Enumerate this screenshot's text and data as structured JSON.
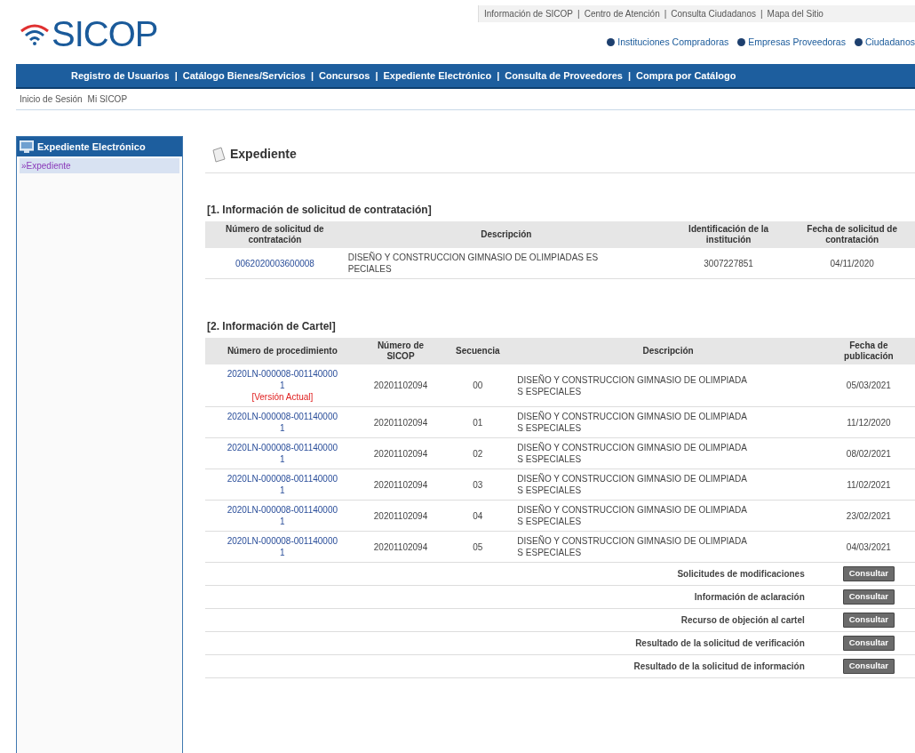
{
  "header": {
    "logo": "SICOP",
    "separator": "|",
    "top_links": [
      "Información de SICOP",
      "Centro de Atención",
      "Consulta Ciudadanos",
      "Mapa del Sitio"
    ],
    "user_links": [
      "Instituciones Compradoras",
      "Empresas Proveedoras",
      "Ciudadanos"
    ]
  },
  "main_nav": {
    "separator": "|",
    "items": [
      "Registro de Usuarios",
      "Catálogo Bienes/Servicios",
      "Concursos",
      "Expediente Electrónico",
      "Consulta de Proveedores",
      "Compra por Catálogo"
    ]
  },
  "breadcrumb": [
    "Inicio de Sesión",
    "Mi SICOP"
  ],
  "sidebar": {
    "title": "Expediente Electrónico",
    "items": [
      {
        "label": "»Expediente",
        "selected": true
      }
    ]
  },
  "page_title": "Expediente",
  "section1": {
    "title": "[1. Información de solicitud de contratación]",
    "columns": [
      "Número de solicitud de contratación",
      "Descripción",
      "Identificación de la institución",
      "Fecha de solicitud de contratación"
    ],
    "rows": [
      {
        "number": "0062020003600008",
        "description": "DISEÑO Y CONSTRUCCION GIMNASIO DE OLIMPIADAS ESPECIALES",
        "institution": "3007227851",
        "date": "04/11/2020"
      }
    ]
  },
  "section2": {
    "title": "[2. Información de Cartel]",
    "columns": [
      "Número de procedimiento",
      "Número de SICOP",
      "Secuencia",
      "Descripción",
      "Fecha de publicación"
    ],
    "rows": [
      {
        "procedure": "2020LN-000008-0011400001",
        "badge": "[Versión Actual]",
        "sicop": "20201102094",
        "sequence": "00",
        "description": "DISEÑO Y CONSTRUCCION GIMNASIO DE OLIMPIADAS ESPECIALES",
        "date": "05/03/2021"
      },
      {
        "procedure": "2020LN-000008-0011400001",
        "sicop": "20201102094",
        "sequence": "01",
        "description": "DISEÑO Y CONSTRUCCION GIMNASIO DE OLIMPIADAS ESPECIALES",
        "date": "11/12/2020"
      },
      {
        "procedure": "2020LN-000008-0011400001",
        "sicop": "20201102094",
        "sequence": "02",
        "description": "DISEÑO Y CONSTRUCCION GIMNASIO DE OLIMPIADAS ESPECIALES",
        "date": "08/02/2021"
      },
      {
        "procedure": "2020LN-000008-0011400001",
        "sicop": "20201102094",
        "sequence": "03",
        "description": "DISEÑO Y CONSTRUCCION GIMNASIO DE OLIMPIADAS ESPECIALES",
        "date": "11/02/2021"
      },
      {
        "procedure": "2020LN-000008-0011400001",
        "sicop": "20201102094",
        "sequence": "04",
        "description": "DISEÑO Y CONSTRUCCION GIMNASIO DE OLIMPIADAS ESPECIALES",
        "date": "23/02/2021"
      },
      {
        "procedure": "2020LN-000008-0011400001",
        "sicop": "20201102094",
        "sequence": "05",
        "description": "DISEÑO Y CONSTRUCCION GIMNASIO DE OLIMPIADAS ESPECIALES",
        "date": "04/03/2021"
      }
    ],
    "actions": [
      {
        "label": "Solicitudes de modificaciones",
        "button": "Consultar"
      },
      {
        "label": "Información de aclaración",
        "button": "Consultar"
      },
      {
        "label": "Recurso de objeción al cartel",
        "button": "Consultar"
      },
      {
        "label": "Resultado de la solicitud de verificación",
        "button": "Consultar"
      },
      {
        "label": "Resultado de la solicitud de información",
        "button": "Consultar"
      }
    ]
  }
}
